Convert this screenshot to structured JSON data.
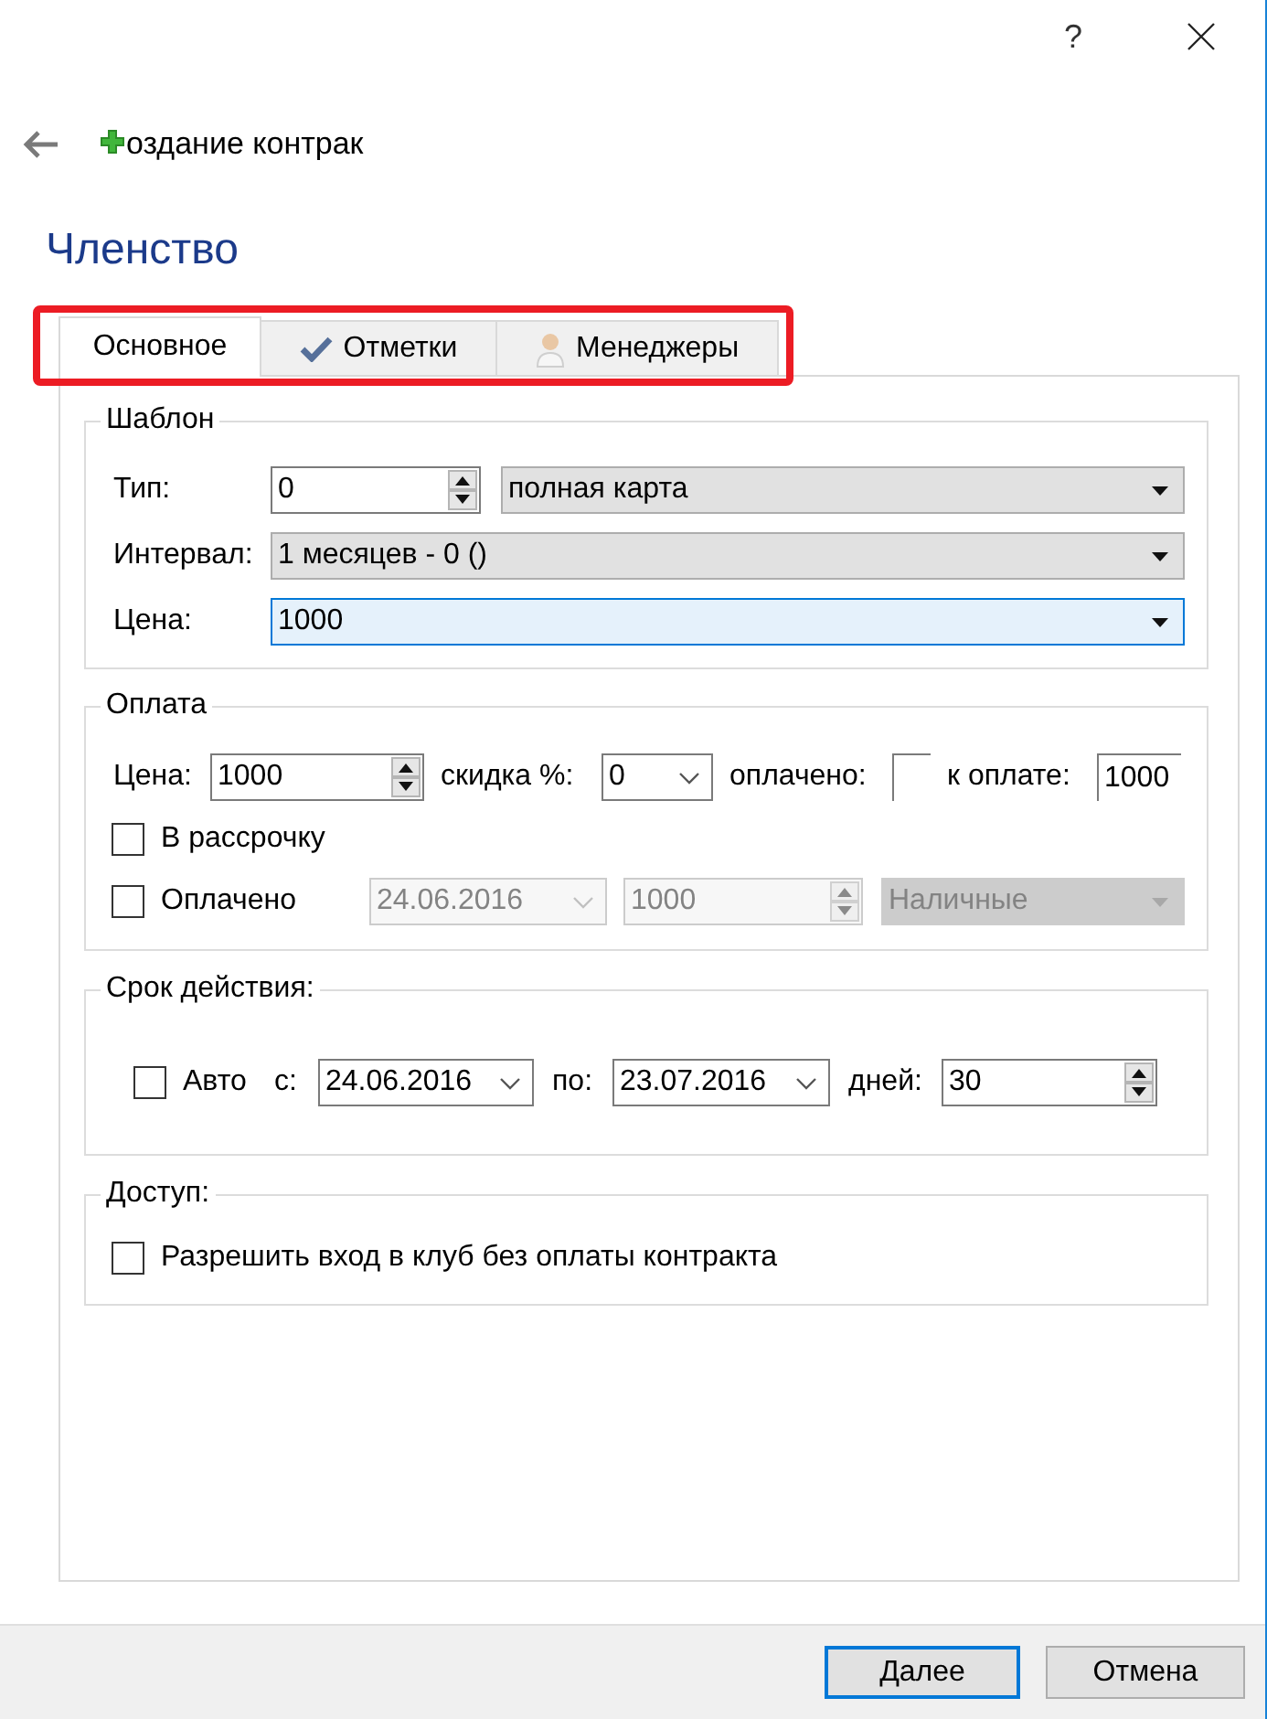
{
  "window": {
    "help": "?"
  },
  "header": {
    "title": "оздание контрак"
  },
  "section_title": "Членство",
  "tabs": [
    {
      "label": "Основное",
      "selected": true
    },
    {
      "label": "Отметки",
      "selected": false
    },
    {
      "label": "Менеджеры",
      "selected": false
    }
  ],
  "template": {
    "title": "Шаблон",
    "type": {
      "label": "Тип:",
      "number": "0",
      "value": "полная карта"
    },
    "interval": {
      "label": "Интервал:",
      "value": "1 месяцев - 0 ()"
    },
    "price": {
      "label": "Цена:",
      "value": "1000",
      "focused": true
    }
  },
  "payment": {
    "title": "Оплата",
    "price": {
      "label": "Цена:",
      "value": "1000"
    },
    "discount": {
      "label": "скидка %:",
      "value": "0"
    },
    "paid": {
      "label": "оплачено:"
    },
    "to_pay": {
      "label": "к оплате:",
      "value": "1000"
    },
    "installments": {
      "label": "В рассрочку",
      "checked": false
    },
    "paid_now": {
      "label": "Оплачено",
      "checked": false,
      "disabled": true,
      "date": "24.06.2016",
      "amount": "1000",
      "method": "Наличные"
    }
  },
  "validity": {
    "title": "Срок действия:",
    "auto": {
      "label": "Авто",
      "checked": false
    },
    "from": {
      "label": "с:",
      "value": "24.06.2016"
    },
    "to": {
      "label": "по:",
      "value": "23.07.2016"
    },
    "days": {
      "label": "дней:",
      "value": "30"
    }
  },
  "access": {
    "title": "Доступ:",
    "allow_unpaid": {
      "label": "Разрешить вход в клуб без оплаты контракта",
      "checked": false
    }
  },
  "buttons": [
    {
      "label": "Далее",
      "default": true
    },
    {
      "label": "Отмена",
      "default": false
    }
  ]
}
